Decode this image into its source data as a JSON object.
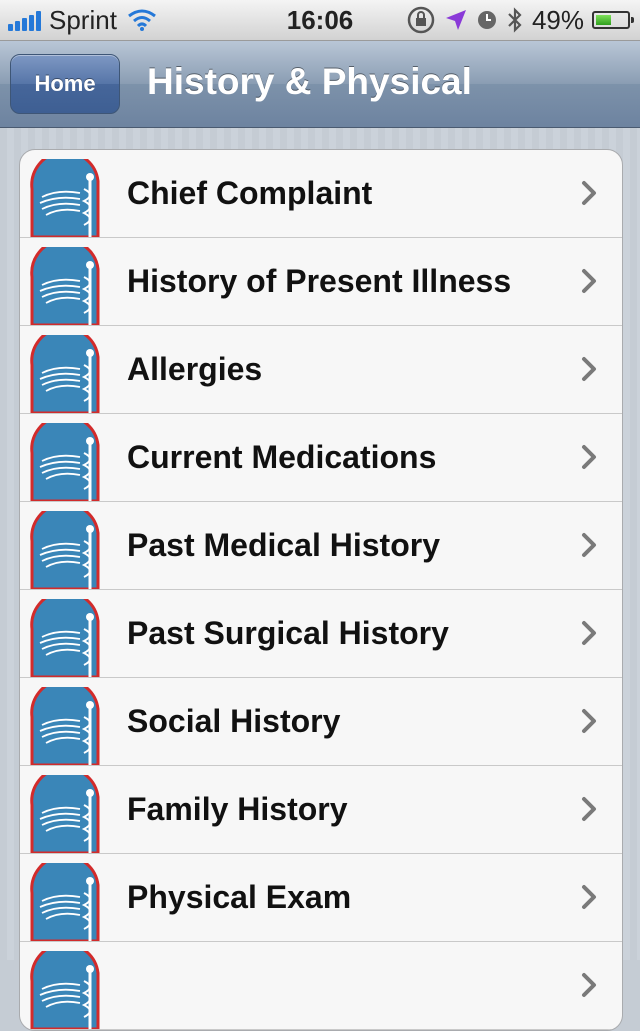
{
  "status_bar": {
    "carrier": "Sprint",
    "time": "16:06",
    "battery": "49%",
    "battery_level": 0.49
  },
  "nav": {
    "back_label": "Home",
    "title": "History & Physical"
  },
  "list": {
    "items": [
      {
        "label": "Chief Complaint"
      },
      {
        "label": "History of Present Illness"
      },
      {
        "label": "Allergies"
      },
      {
        "label": "Current Medications"
      },
      {
        "label": "Past Medical History"
      },
      {
        "label": "Past Surgical History"
      },
      {
        "label": "Social History"
      },
      {
        "label": "Family History"
      },
      {
        "label": "Physical Exam"
      },
      {
        "label": ""
      }
    ],
    "icon": "caduceus-icon",
    "accessory": "chevron-right-icon"
  },
  "colors": {
    "icon_fill": "#3a86b8",
    "icon_border": "#d22b2b",
    "nav_accent": "#6d83a0"
  }
}
